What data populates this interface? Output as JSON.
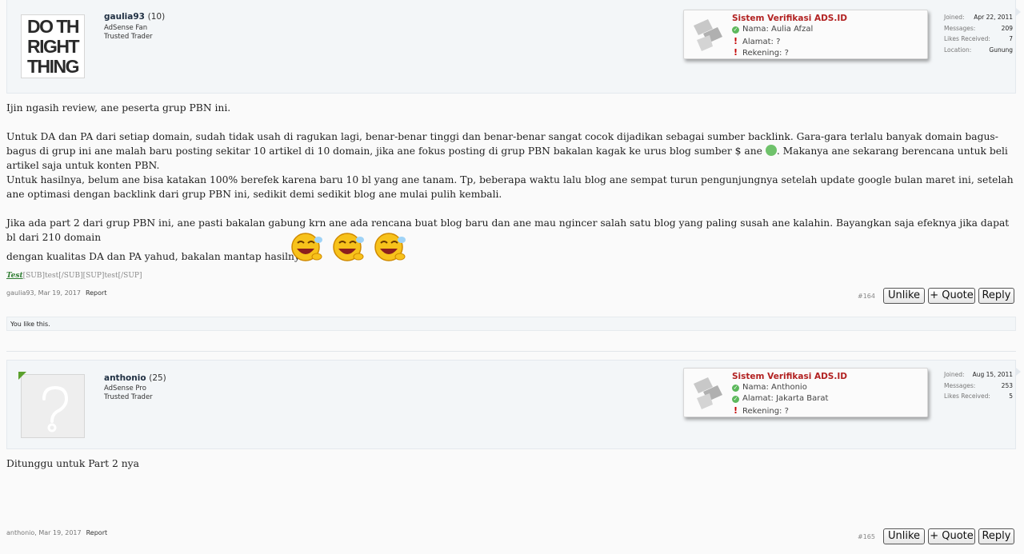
{
  "posts": [
    {
      "username": "gaulia93",
      "user_count": "(10)",
      "user_titles": [
        "AdSense Fan",
        "Trusted Trader"
      ],
      "avatar_text": [
        "DO TH",
        "RIGHT",
        "THING"
      ],
      "verification": {
        "title": "Sistem Verifikasi ADS.ID",
        "rows": [
          {
            "status": "ok",
            "text": "Nama: Aulia Afzal"
          },
          {
            "status": "bad",
            "text": "Alamat: ?"
          },
          {
            "status": "bad",
            "text": "Rekening: ?"
          }
        ]
      },
      "stats": [
        {
          "label": "Joined:",
          "value": "Apr 22, 2011"
        },
        {
          "label": "Messages:",
          "value": "209"
        },
        {
          "label": "Likes Received:",
          "value": "7"
        },
        {
          "label": "Location:",
          "value": "Gunung"
        }
      ],
      "message": {
        "p1": "Ijin ngasih review, ane peserta grup PBN ini.",
        "p2a": "Untuk DA dan PA dari setiap domain, sudah tidak usah di ragukan lagi, benar-benar tinggi dan benar-benar sangat cocok dijadikan sebagai sumber backlink. Gara-gara terlalu banyak domain bagus-bagus di grup ini ane malah baru posting sekitar 10 artikel di 10 domain, jika ane fokus posting di grup PBN bakalan kagak ke urus blog sumber $ ane",
        "p2b": ". Makanya ane sekarang berencana untuk beli artikel saja untuk konten PBN.",
        "p3": "Untuk hasilnya, belum ane bisa katakan 100% berefek karena baru 10 bl yang ane tanam. Tp, beberapa waktu lalu blog ane sempat turun pengunjungnya setelah update google bulan maret ini, setelah ane optimasi dengan backlink dari grup PBN ini, sedikit demi sedikit blog ane mulai pulih kembali.",
        "p4": "Jika ada part 2 dari grup PBN ini, ane pasti bakalan gabung krn ane ada rencana buat blog baru dan ane mau ngincer salah satu blog yang paling susah ane kalahin. Bayangkan saja efeknya jika dapat bl dari 210 domain",
        "p5": "dengan kualitas DA dan PA yahud, bakalan mantap hasilnya"
      },
      "signature": {
        "link": "Test",
        "rest": "[SUB]test[/SUB][SUP]test[/SUP]"
      },
      "meta": {
        "author_date": "gaulia93, Mar 19, 2017",
        "report": "Report"
      },
      "post_number": "#164",
      "buttons": {
        "like": "Unlike",
        "quote": "+ Quote",
        "reply": "Reply"
      },
      "likes_text": "You like this."
    },
    {
      "username": "anthonio",
      "user_count": "(25)",
      "user_titles": [
        "AdSense Pro",
        "Trusted Trader"
      ],
      "verification": {
        "title": "Sistem Verifikasi ADS.ID",
        "rows": [
          {
            "status": "ok",
            "text": "Nama: Anthonio"
          },
          {
            "status": "ok",
            "text": "Alamat: Jakarta Barat"
          },
          {
            "status": "bad",
            "text": "Rekening: ?"
          }
        ]
      },
      "stats": [
        {
          "label": "Joined:",
          "value": "Aug 15, 2011"
        },
        {
          "label": "Messages:",
          "value": "253"
        },
        {
          "label": "Likes Received:",
          "value": "5"
        }
      ],
      "message": {
        "p1": "Ditunggu untuk Part 2 nya"
      },
      "meta": {
        "author_date": "anthonio, Mar 19, 2017",
        "report": "Report"
      },
      "post_number": "#165",
      "buttons": {
        "like": "Unlike",
        "quote": "+ Quote",
        "reply": "Reply"
      }
    }
  ],
  "colors": {
    "verif_title": "#b22222",
    "ok": "#5cb85c",
    "bad": "#c40000",
    "sig_link": "#2f7d32"
  },
  "icons": [
    "check-icon",
    "exclamation-icon",
    "ads-logo-icon",
    "laughing-emoji-icon",
    "grin-emoji-icon"
  ]
}
